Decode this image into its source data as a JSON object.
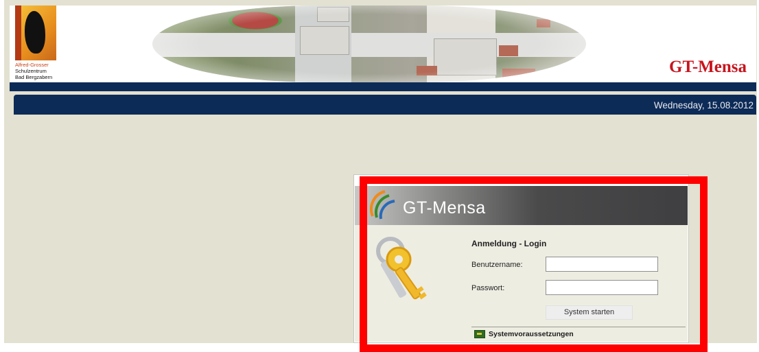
{
  "header": {
    "logo_lines": [
      "Alfred-Grosser",
      "Schulzentrum",
      "Bad Bergzabern"
    ],
    "site_title": "GT-Mensa"
  },
  "datebar": {
    "date_text": "Wednesday, 15.08.2012"
  },
  "login": {
    "banner_title": "GT-Mensa",
    "heading": "Anmeldung - Login",
    "username_label": "Benutzername:",
    "username_value": "",
    "password_label": "Passwort:",
    "password_value": "",
    "submit_label": "System starten",
    "requirements_link": "Systemvoraussetzungen"
  },
  "colors": {
    "navy": "#0d2b57",
    "title_red": "#c8141e",
    "highlight_red": "#ff0000",
    "page_background": "#e3e1d1"
  },
  "icons": [
    "keys-icon",
    "swirl-logo-icon",
    "system-requirements-icon"
  ]
}
